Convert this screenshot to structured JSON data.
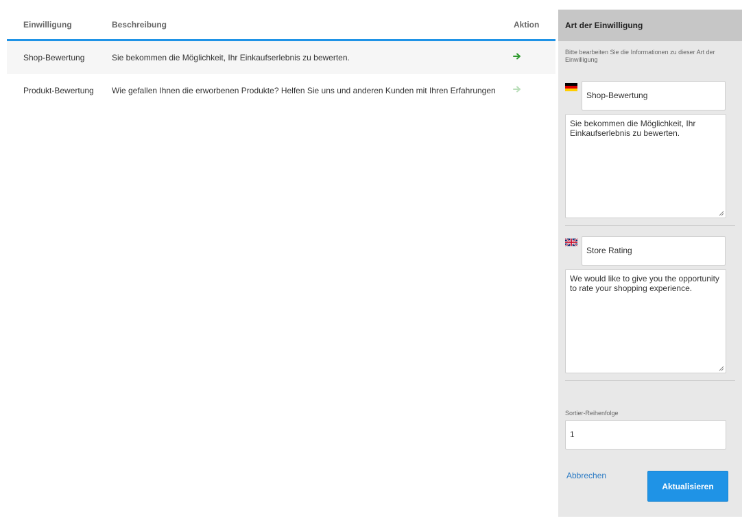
{
  "table": {
    "headers": {
      "consent": "Einwilligung",
      "description": "Beschreibung",
      "action": "Aktion"
    },
    "rows": [
      {
        "name": "Shop-Bewertung",
        "description": "Sie bekommen die Möglichkeit, Ihr Einkaufserlebnis zu bewerten.",
        "action_icon": "arrow-right-icon",
        "action_color": "#2e9a2e"
      },
      {
        "name": "Produkt-Bewertung",
        "description": "Wie gefallen Ihnen die erworbenen Produkte? Helfen Sie uns und anderen Kunden mit Ihren Erfahrungen",
        "action_icon": "arrow-right-icon",
        "action_color": "#b9deb9"
      }
    ],
    "accent_color": "#1f93e6"
  },
  "panel": {
    "title": "Art der Einwilligung",
    "note": "Bitte bearbeiten Sie die Informationen zu dieser Art der Einwilligung",
    "german": {
      "flag": "de-flag-icon",
      "title_value": "Shop-Bewertung",
      "description_value": "Sie bekommen die Möglichkeit, Ihr Einkaufserlebnis zu bewerten."
    },
    "english": {
      "flag": "gb-flag-icon",
      "title_value": "Store Rating",
      "description_value": "We would like to give you the opportunity to rate your shopping experience."
    },
    "sort_order": {
      "label": "Sortier-Reihenfolge",
      "value": "1"
    },
    "cancel_label": "Abbrechen",
    "update_label": "Aktualisieren"
  }
}
